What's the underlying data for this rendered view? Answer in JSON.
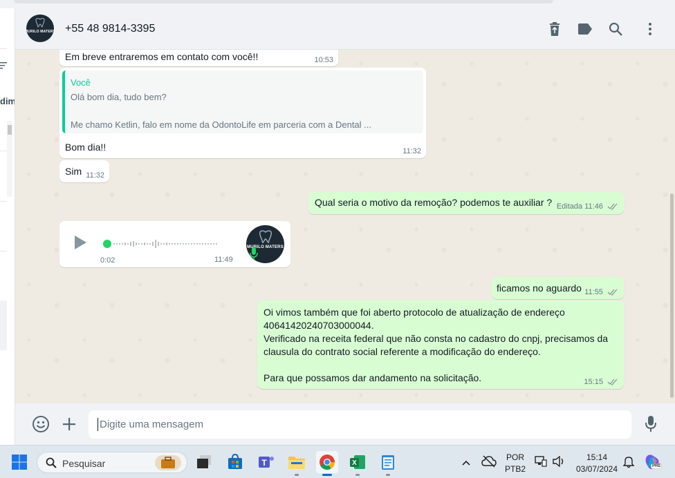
{
  "header": {
    "contact_name": "+55 48 9814-3395",
    "avatar_text": "MURILO MATERS",
    "icons": [
      "trash-icon",
      "label-icon",
      "search-icon",
      "menu-icon"
    ]
  },
  "left_panel": {
    "partial_text": "dim"
  },
  "messages": [
    {
      "id": "m1",
      "direction": "in",
      "text": "Em breve entraremos em contato com você!!",
      "time": "10:53"
    },
    {
      "id": "m2",
      "direction": "in",
      "quote": {
        "author": "Você",
        "line1": "Olá bom dia, tudo bem?",
        "line2": "Me chamo Ketlin, falo em nome da OdontoLife em parceria com a Dental ..."
      },
      "text": "Bom dia!!",
      "time": "11:32"
    },
    {
      "id": "m3",
      "direction": "in",
      "text": "Sim",
      "time": "11:32"
    },
    {
      "id": "m4",
      "direction": "out",
      "text": "Qual seria o motivo da remoção? podemos te auxiliar ?",
      "edited": "Editada",
      "time": "11:46"
    },
    {
      "id": "m5",
      "direction": "in",
      "type": "audio",
      "duration": "0:02",
      "time": "11:49"
    },
    {
      "id": "m6",
      "direction": "out",
      "text": "ficamos no aguardo",
      "time": "11:55"
    },
    {
      "id": "m7",
      "direction": "out",
      "lines": [
        "Oi vimos também que foi aberto protocolo de atualização de endereço",
        "40641420240703000044.",
        "Verificado na receita federal que não consta no cadastro do cnpj, precisamos da",
        "clausula do contrato social referente a modificação do endereço.",
        "",
        "Para que possamos dar andamento na solicitação."
      ],
      "time": "15:15"
    }
  ],
  "composer": {
    "placeholder": "Digite uma mensagem"
  },
  "taskbar": {
    "search_label": "Pesquisar",
    "lang_top": "POR",
    "lang_bottom": "PTB2",
    "clock_time": "15:14",
    "clock_date": "03/07/2024",
    "copilot_badge": "PRE"
  },
  "colors": {
    "accent_green": "#06cf9c",
    "outgoing_bubble": "#d9fdd3",
    "incoming_bubble": "#ffffff",
    "chat_background": "#efeae2"
  }
}
